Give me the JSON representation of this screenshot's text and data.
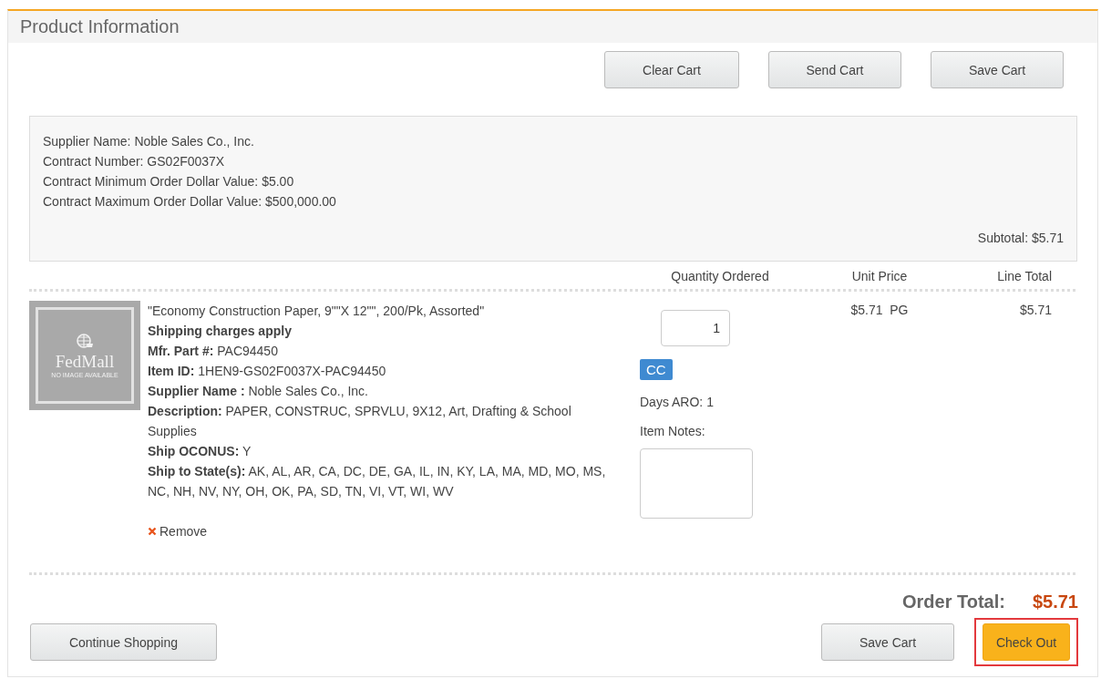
{
  "panel": {
    "title": "Product Information"
  },
  "top_buttons": [
    "Clear Cart",
    "Send Cart",
    "Save Cart"
  ],
  "supplier": {
    "lines": [
      "Supplier Name: Noble Sales Co., Inc.",
      "Contract Number: GS02F0037X",
      "Contract Minimum Order Dollar Value: $5.00",
      "Contract Maximum Order Dollar Value: $500,000.00"
    ],
    "subtotal": "Subtotal: $5.71"
  },
  "columns": [
    "Quantity Ordered",
    "Unit Price",
    "Line Total"
  ],
  "item": {
    "image": {
      "brand": "FedMall",
      "caption": "NO IMAGE AVAILABLE"
    },
    "details": [
      {
        "kind": "plain",
        "text": "\"Economy Construction Paper, 9\"\"X 12\"\", 200/Pk, Assorted\""
      },
      {
        "kind": "bold",
        "text": "Shipping charges apply"
      },
      {
        "kind": "field",
        "text": "**Mfr. Part #:** PAC94450"
      },
      {
        "kind": "field",
        "text": "**Item ID:** 1HEN9-GS02F0037X-PAC94450"
      },
      {
        "kind": "field",
        "text": "**Supplier Name :** Noble Sales Co., Inc."
      },
      {
        "kind": "field",
        "text": "**Description:** PAPER, CONSTRUC, SPRVLU, 9X12, Art, Drafting & School Supplies"
      },
      {
        "kind": "field",
        "text": "**Ship OCONUS:** Y"
      },
      {
        "kind": "field",
        "text": "**Ship to State(s):** AK, AL, AR, CA, DC, DE, GA, IL, IN, KY, LA, MA, MD, MO, MS, NC, NH, NV, NY, OH, OK, PA, SD, TN, VI, VT, WI, WV"
      }
    ],
    "remove": "Remove",
    "quantity": "1",
    "tag": "CC",
    "days_aro": "Days ARO: 1",
    "notes_label": "Item Notes:",
    "unit_price": "$5.71  PG",
    "line_total": "$5.71"
  },
  "order_total": {
    "label": "Order Total:",
    "value": "$5.71"
  },
  "bottom_buttons": [
    {
      "label": "Continue Shopping",
      "kind": "default"
    },
    {
      "label": "Save Cart",
      "kind": "default"
    },
    {
      "label": "Check Out",
      "kind": "primary"
    }
  ]
}
